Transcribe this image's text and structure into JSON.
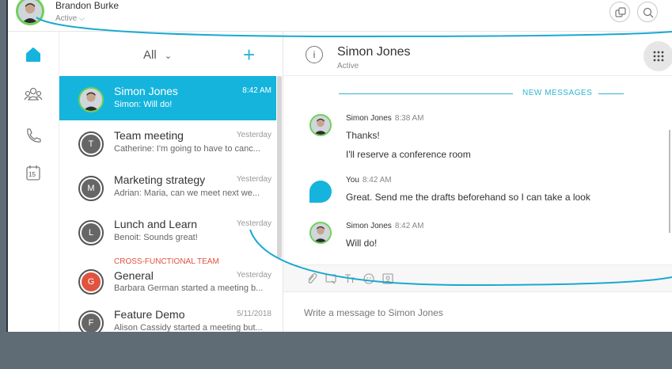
{
  "user": {
    "name": "Brandon Burke",
    "status": "Active"
  },
  "list": {
    "filter_label": "All",
    "items": [
      {
        "title": "Simon Jones",
        "time": "8:42 AM",
        "preview": "Simon: Will do!",
        "initial": "",
        "selected": true
      },
      {
        "title": "Team meeting",
        "time": "Yesterday",
        "preview": "Catherine: I'm going to have to canc...",
        "initial": "T"
      },
      {
        "title": "Marketing strategy",
        "time": "Yesterday",
        "preview": "Adrian: Maria, can we meet next we...",
        "initial": "M"
      },
      {
        "title": "Lunch and Learn",
        "time": "Yesterday",
        "preview": "Benoit: Sounds great!",
        "initial": "L"
      },
      {
        "tag": "CROSS-FUNCTIONAL TEAM",
        "title": "General",
        "time": "Yesterday",
        "preview": "Barbara German started a meeting b...",
        "initial": "G"
      },
      {
        "title": "Feature Demo",
        "time": "5/11/2018",
        "preview": "Alison Cassidy started a meeting but...",
        "initial": "F"
      }
    ]
  },
  "chat": {
    "name": "Simon Jones",
    "status": "Active",
    "info_glyph": "i",
    "new_messages_label": "NEW MESSAGES",
    "messages": [
      {
        "sender": "Simon Jones",
        "time": "8:38 AM",
        "lines": [
          "Thanks!",
          "I'll reserve a conference room"
        ]
      },
      {
        "sender": "You",
        "time": "8:42 AM",
        "lines": [
          "Great. Send me the drafts beforehand so I can take a look"
        ]
      },
      {
        "sender": "Simon Jones",
        "time": "8:42 AM",
        "lines": [
          "Will do!"
        ]
      }
    ],
    "compose_placeholder": "Write a message to Simon Jones"
  },
  "rail": {
    "calendar_day": "15"
  },
  "icons": {
    "home": "home-icon",
    "contacts": "contacts-icon",
    "phone": "phone-icon",
    "calendar": "calendar-icon",
    "attach": "paperclip-icon",
    "screenshot": "screen-capture-icon",
    "format": "text-format-icon",
    "emoji": "emoji-icon",
    "image": "image-icon"
  },
  "colors": {
    "accent": "#14b4dc",
    "presence": "#6fcf5a",
    "tag": "#e0533f",
    "general_avatar": "#e0533f"
  }
}
